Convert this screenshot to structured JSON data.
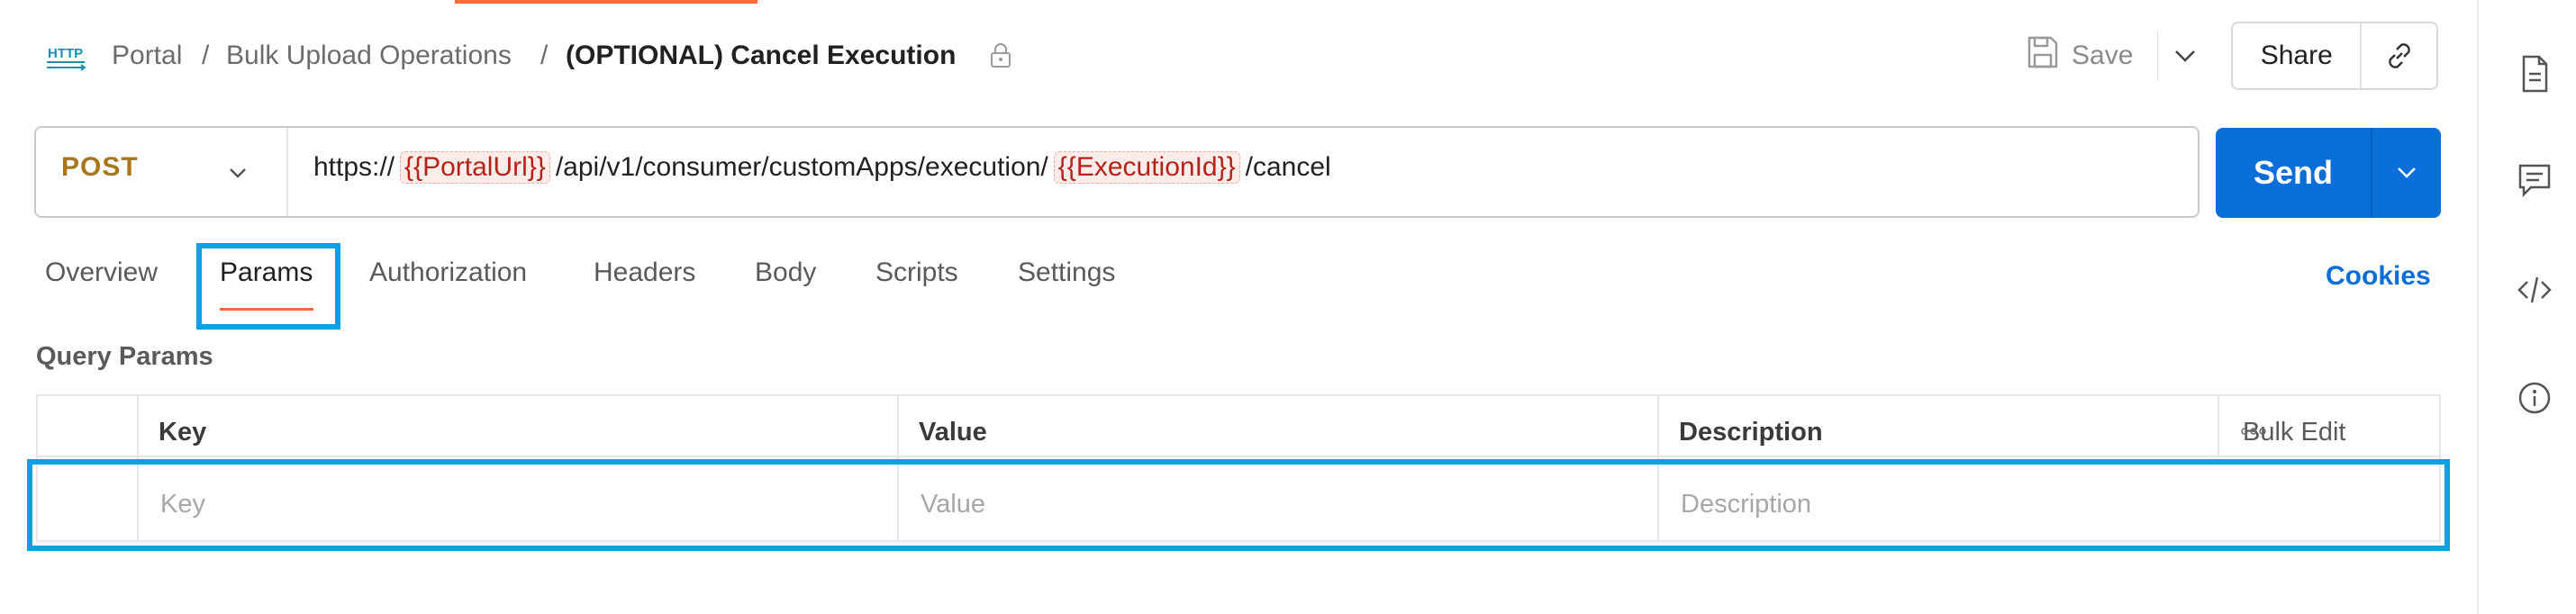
{
  "header": {
    "request_type_icon": "http-icon",
    "breadcrumb": [
      "Portal",
      "Bulk Upload Operations"
    ],
    "separator": "/",
    "title": "(OPTIONAL) Cancel Execution",
    "save_label": "Save",
    "share_label": "Share"
  },
  "request": {
    "method": "POST",
    "url_parts": [
      {
        "text": "https://",
        "variable": false
      },
      {
        "text": "{{PortalUrl}}",
        "variable": true
      },
      {
        "text": "/api/v1/consumer/customApps/execution/",
        "variable": false
      },
      {
        "text": "{{ExecutionId}}",
        "variable": true
      },
      {
        "text": "/cancel",
        "variable": false
      }
    ],
    "send_label": "Send"
  },
  "tabs": [
    {
      "label": "Overview",
      "active": false
    },
    {
      "label": "Params",
      "active": true
    },
    {
      "label": "Authorization",
      "active": false
    },
    {
      "label": "Headers",
      "active": false
    },
    {
      "label": "Body",
      "active": false
    },
    {
      "label": "Scripts",
      "active": false
    },
    {
      "label": "Settings",
      "active": false
    }
  ],
  "cookies_label": "Cookies",
  "query_params": {
    "title": "Query Params",
    "columns": [
      "Key",
      "Value",
      "Description"
    ],
    "bulk_edit_label": "Bulk Edit",
    "placeholders": {
      "key": "Key",
      "value": "Value",
      "description": "Description"
    }
  },
  "right_rail": [
    "document-icon",
    "comment-icon",
    "code-icon",
    "info-icon"
  ],
  "colors": {
    "accent_orange": "#ff6c37",
    "send_blue": "#0a6ed8",
    "highlight_blue": "#0ba0e0",
    "method_post": "#a8761b",
    "variable_red": "#b42318"
  }
}
